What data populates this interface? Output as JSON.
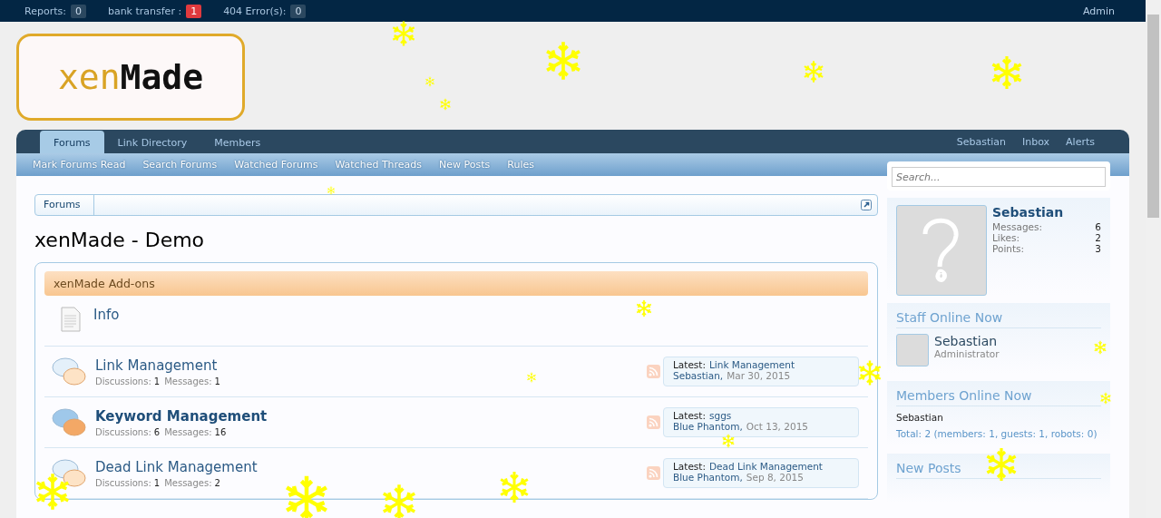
{
  "top_bar": {
    "counters": [
      {
        "label": "Reports:",
        "count": "0",
        "alert": false
      },
      {
        "label": "bank transfer :",
        "count": "1",
        "alert": true
      },
      {
        "label": "404 Error(s):",
        "count": "0",
        "alert": false
      }
    ],
    "user": "Admin"
  },
  "logo": {
    "light": "xen",
    "dark": "Made"
  },
  "nav": {
    "tabs": [
      {
        "label": "Forums",
        "selected": true
      },
      {
        "label": "Link Directory",
        "selected": false
      },
      {
        "label": "Members",
        "selected": false
      }
    ],
    "account_links": [
      "Sebastian",
      "Inbox",
      "Alerts"
    ],
    "sub_links": [
      "Mark Forums Read",
      "Search Forums",
      "Watched Forums",
      "Watched Threads",
      "New Posts",
      "Rules"
    ]
  },
  "search": {
    "placeholder": "Search..."
  },
  "breadcrumb": [
    "Forums"
  ],
  "page_title": "xenMade - Demo",
  "category": {
    "title": "xenMade Add-ons",
    "nodes": [
      {
        "kind": "page",
        "title": "Info"
      },
      {
        "kind": "forum",
        "title": "Link Management",
        "unread": false,
        "discussions_label": "Discussions:",
        "discussions": "1",
        "messages_label": "Messages:",
        "messages": "1",
        "latest_label": "Latest:",
        "latest_title": "Link Management",
        "latest_user": "Sebastian,",
        "latest_date": "Mar 30, 2015"
      },
      {
        "kind": "forum",
        "title": "Keyword Management",
        "unread": true,
        "discussions_label": "Discussions:",
        "discussions": "6",
        "messages_label": "Messages:",
        "messages": "16",
        "latest_label": "Latest:",
        "latest_title": "sggs",
        "latest_user": "Blue Phantom,",
        "latest_date": "Oct 13, 2015"
      },
      {
        "kind": "forum",
        "title": "Dead Link Management",
        "unread": false,
        "discussions_label": "Discussions:",
        "discussions": "1",
        "messages_label": "Messages:",
        "messages": "2",
        "latest_label": "Latest:",
        "latest_title": "Dead Link Management",
        "latest_user": "Blue Phantom,",
        "latest_date": "Sep 8, 2015"
      }
    ]
  },
  "visitor": {
    "name": "Sebastian",
    "stats": [
      {
        "label": "Messages:",
        "value": "6"
      },
      {
        "label": "Likes:",
        "value": "2"
      },
      {
        "label": "Points:",
        "value": "3"
      }
    ]
  },
  "staff_online": {
    "title": "Staff Online Now",
    "members": [
      {
        "name": "Sebastian",
        "role": "Administrator"
      }
    ]
  },
  "members_online": {
    "title": "Members Online Now",
    "names": "Sebastian",
    "total": "Total: 2 (members: 1, guests: 1, robots: 0)"
  },
  "new_posts": {
    "title": "New Posts"
  }
}
